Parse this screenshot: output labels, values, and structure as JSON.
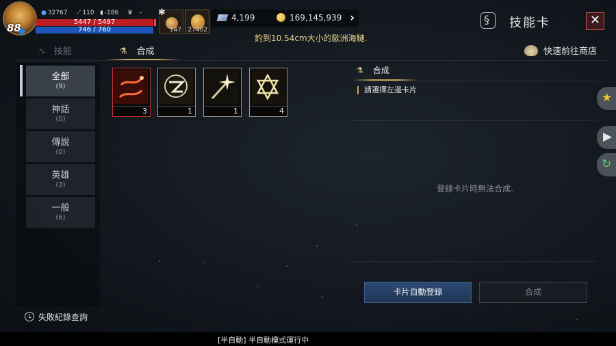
{
  "hud": {
    "level": "88",
    "power": "32767",
    "stat_a": "110",
    "stat_b": "-186",
    "stat_c": "-",
    "hp": "5447 / 5497",
    "mp": "746 / 760",
    "slot1_count": "147",
    "slot2_count": "27402"
  },
  "currency": {
    "gems": "4,199",
    "gold": "169,145,939"
  },
  "notice": "釣到10.54cm大小的歐洲海鰱.",
  "window": {
    "title": "技能卡",
    "close_icon": "close-icon"
  },
  "tabs": {
    "skill": "技能",
    "synth": "合成",
    "shop_link": "快速前往商店"
  },
  "sidebar": {
    "categories": [
      {
        "name": "全部",
        "count": "(9)"
      },
      {
        "name": "神話",
        "count": "(0)"
      },
      {
        "name": "傳說",
        "count": "(0)"
      },
      {
        "name": "英雄",
        "count": "(3)"
      },
      {
        "name": "一般",
        "count": "(6)"
      }
    ],
    "history": "失敗紀錄查詢"
  },
  "cards": [
    {
      "count": "3",
      "color": "#e04a2a",
      "icon": "serpent-flame-icon"
    },
    {
      "count": "1",
      "color": "#e8e0c0",
      "icon": "arcane-sigil-icon"
    },
    {
      "count": "1",
      "color": "#f0e6c0",
      "icon": "starburst-staff-icon"
    },
    {
      "count": "4",
      "color": "#efe2a8",
      "icon": "hexagram-icon"
    }
  ],
  "panel": {
    "header": "合成",
    "hint": "請選擇左邊卡片",
    "message": "登錄卡片時無法合成.",
    "btn_auto": "卡片自動登錄",
    "btn_synth": "合成"
  },
  "status": "[半自動] 半自動模式運行中"
}
